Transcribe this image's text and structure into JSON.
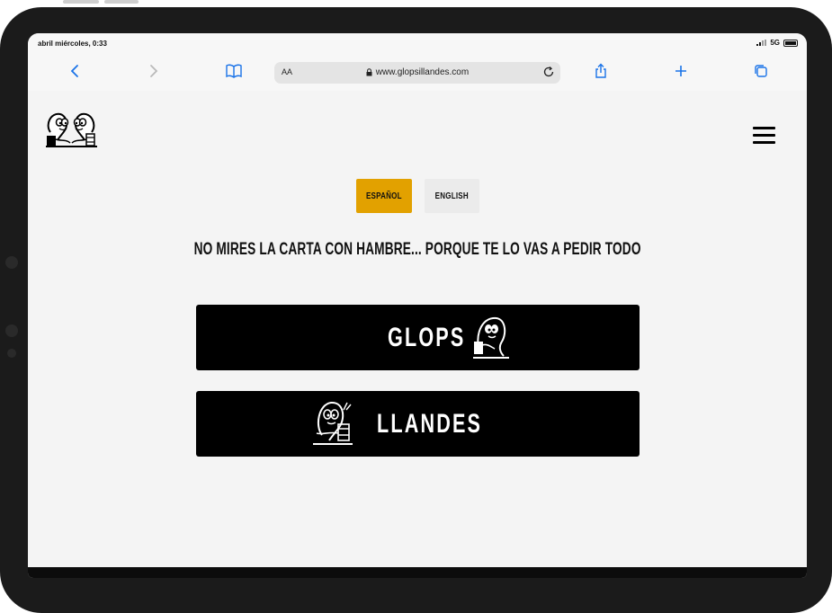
{
  "status": {
    "time": "abril miércoles, 0:33",
    "network": "5G"
  },
  "browser": {
    "reader_label": "AA",
    "url": "www.glopsillandes.com",
    "icons": [
      "back-icon",
      "forward-icon",
      "bookmarks-icon",
      "lock-icon",
      "reload-icon",
      "share-icon",
      "new-tab-icon",
      "tabs-icon"
    ]
  },
  "site": {
    "languages": {
      "spanish": "ESPAÑOL",
      "english": "ENGLISH"
    },
    "tagline": "NO MIRES LA CARTA CON HAMBRE... PORQUE TE LO VAS A PEDIR TODO",
    "buttons": {
      "glops": "GLOPS",
      "llandes": "LLANDES"
    },
    "colors": {
      "active_language": "#e2a100",
      "button_bg": "#000000",
      "page_bg": "#f4f4f4"
    }
  }
}
